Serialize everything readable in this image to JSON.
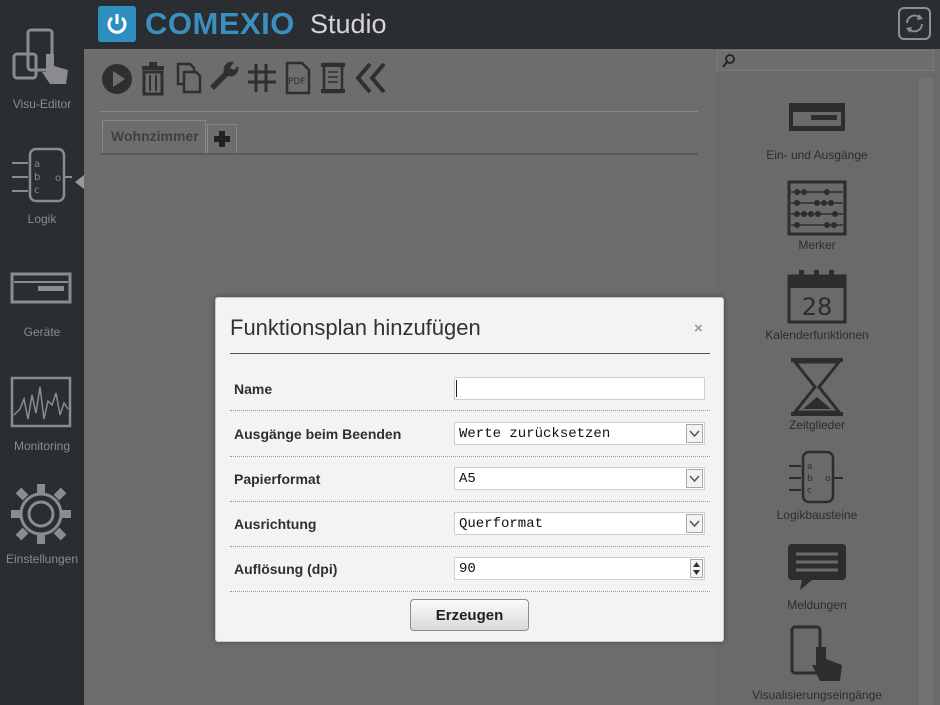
{
  "app": {
    "brand": "COMEXIO",
    "product": "Studio"
  },
  "sidebar": {
    "items": [
      {
        "label": "Visu-Editor",
        "icon": "tablet-touch-icon"
      },
      {
        "label": "Logik",
        "icon": "logic-block-icon"
      },
      {
        "label": "Geräte",
        "icon": "device-icon"
      },
      {
        "label": "Monitoring",
        "icon": "monitoring-chart-icon"
      },
      {
        "label": "Einstellungen",
        "icon": "gear-icon"
      }
    ]
  },
  "toolbar": {
    "pdf_label": "PDF",
    "icons": [
      "play-icon",
      "trash-icon",
      "copy-icon",
      "wrench-icon",
      "grid-icon",
      "pdf-icon",
      "scroll-icon",
      "collapse-icon"
    ]
  },
  "tabs": [
    {
      "label": "Wohnzimmer"
    }
  ],
  "library": {
    "items": [
      {
        "label": "Ein- und Ausgänge",
        "icon": "io-device-icon"
      },
      {
        "label": "Merker",
        "icon": "abacus-icon"
      },
      {
        "label": "Kalenderfunktionen",
        "icon": "calendar-icon",
        "calendar_day": "28"
      },
      {
        "label": "Zeitglieder",
        "icon": "hourglass-icon"
      },
      {
        "label": "Logikbausteine",
        "icon": "logic-block-icon"
      },
      {
        "label": "Meldungen",
        "icon": "message-icon"
      },
      {
        "label": "Visualisierungseingänge",
        "icon": "tablet-touch-icon"
      }
    ]
  },
  "dialog": {
    "title": "Funktionsplan hinzufügen",
    "close": "×",
    "fields": {
      "name": {
        "label": "Name",
        "value": ""
      },
      "outputs": {
        "label": "Ausgänge beim Beenden",
        "value": "Werte zurücksetzen"
      },
      "paper": {
        "label": "Papierformat",
        "value": "A5"
      },
      "orientation": {
        "label": "Ausrichtung",
        "value": "Querformat"
      },
      "resolution": {
        "label": "Auflösung (dpi)",
        "value": "90"
      }
    },
    "submit": "Erzeugen"
  },
  "colors": {
    "accent": "#3a8fbf",
    "sidebar_bg": "#2a2d31",
    "dialog_bg": "#f2f3f4"
  }
}
